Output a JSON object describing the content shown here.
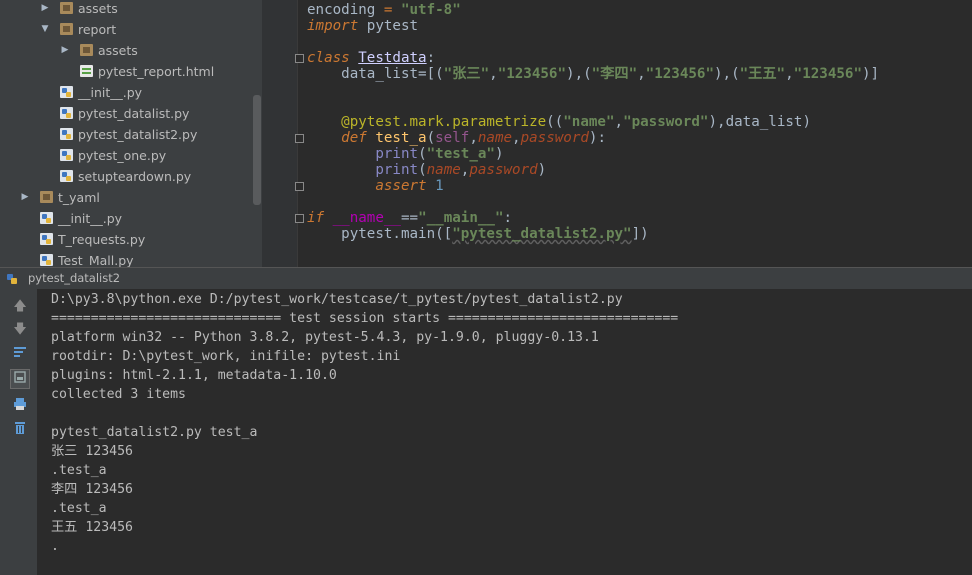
{
  "tree": {
    "items": [
      {
        "label": "assets",
        "type": "folder",
        "arrow": "right"
      },
      {
        "label": "report",
        "type": "folder",
        "arrow": "down"
      },
      {
        "label": "assets",
        "type": "folder",
        "arrow": "right"
      },
      {
        "label": "pytest_report.html",
        "type": "html"
      },
      {
        "label": "__init__.py",
        "type": "py"
      },
      {
        "label": "pytest_datalist.py",
        "type": "py"
      },
      {
        "label": "pytest_datalist2.py",
        "type": "py"
      },
      {
        "label": "pytest_one.py",
        "type": "py"
      },
      {
        "label": "setupteardown.py",
        "type": "py"
      },
      {
        "label": "t_yaml",
        "type": "folder",
        "arrow": "right"
      },
      {
        "label": "__init__.py",
        "type": "py"
      },
      {
        "label": "T_requests.py",
        "type": "py"
      },
      {
        "label": "Test_Mall.py",
        "type": "py"
      }
    ]
  },
  "editor": {
    "lines": [
      {
        "text": "encoding = \"utf-8\""
      },
      {
        "text": "import pytest"
      },
      {
        "text": ""
      },
      {
        "text": "class Testdata:"
      },
      {
        "text": "    data_list=[(\"张三\",\"123456\"),(\"李四\",\"123456\"),(\"王五\",\"123456\")]"
      },
      {
        "text": ""
      },
      {
        "text": ""
      },
      {
        "text": "    @pytest.mark.parametrize((\"name\",\"password\"),data_list)"
      },
      {
        "text": "    def test_a(self,name,password):"
      },
      {
        "text": "        print(\"test_a\")"
      },
      {
        "text": "        print(name,password)"
      },
      {
        "text": "        assert 1"
      },
      {
        "text": ""
      },
      {
        "text": "if __name__==\"__main__\":"
      },
      {
        "text": "    pytest.main([\"pytest_datalist2.py\"])"
      }
    ]
  },
  "run": {
    "title": "pytest_datalist2",
    "console": [
      "D:\\py3.8\\python.exe D:/pytest_work/testcase/t_pytest/pytest_datalist2.py",
      "============================= test session starts =============================",
      "platform win32 -- Python 3.8.2, pytest-5.4.3, py-1.9.0, pluggy-0.13.1",
      "rootdir: D:\\pytest_work, inifile: pytest.ini",
      "plugins: html-2.1.1, metadata-1.10.0",
      "collected 3 items",
      "",
      "pytest_datalist2.py test_a",
      "张三 123456",
      ".test_a",
      "李四 123456",
      ".test_a",
      "王五 123456",
      "."
    ]
  }
}
